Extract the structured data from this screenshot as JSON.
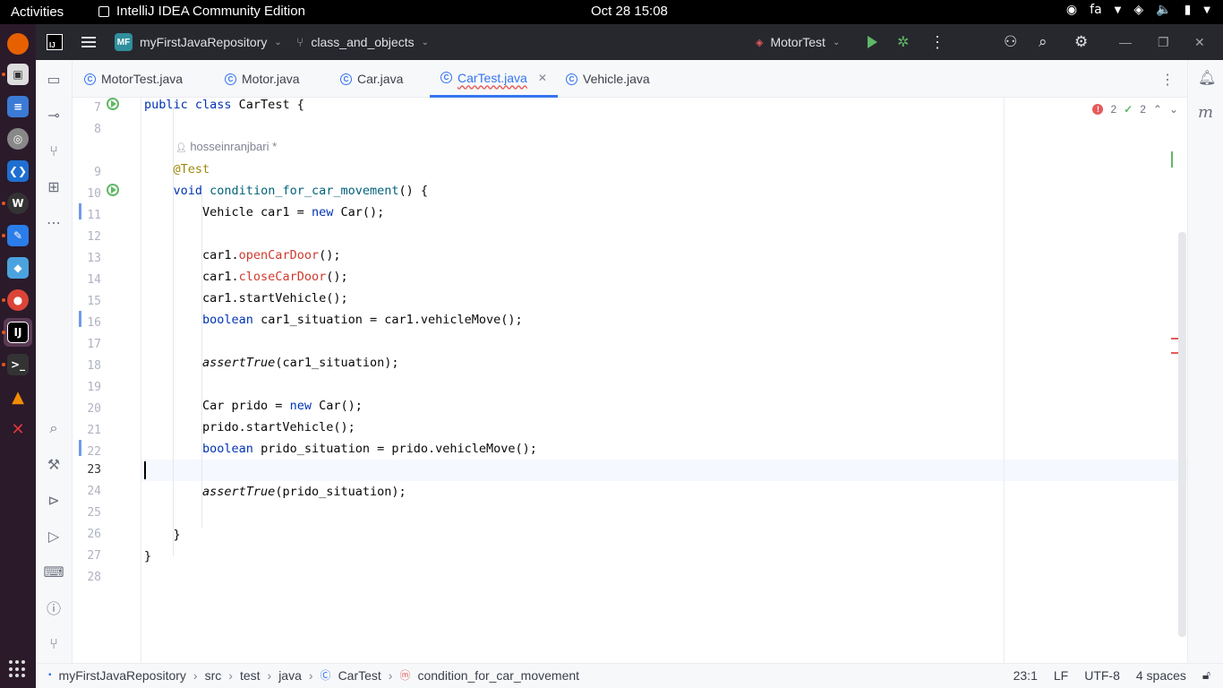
{
  "system": {
    "activities": "Activities",
    "app_name": "IntelliJ IDEA Community Edition",
    "clock": "Oct 28  15:08",
    "keyboard_layout": "fa"
  },
  "toolbar": {
    "project_badge": "MF",
    "project_name": "myFirstJavaRepository",
    "branch": "class_and_objects",
    "run_config": "MotorTest"
  },
  "tabs": [
    {
      "label": "MotorTest.java"
    },
    {
      "label": "Motor.java"
    },
    {
      "label": "Car.java"
    },
    {
      "label": "CarTest.java"
    },
    {
      "label": "Vehicle.java"
    }
  ],
  "editor": {
    "author_hint": "hosseinranjbari *",
    "errors_count": "2",
    "warnings_count": "2",
    "right_strip_letter": "m",
    "line_numbers": [
      "7",
      "8",
      "9",
      "10",
      "11",
      "12",
      "13",
      "14",
      "15",
      "16",
      "17",
      "18",
      "19",
      "20",
      "21",
      "22",
      "23",
      "24",
      "25",
      "26",
      "27",
      "28"
    ]
  },
  "statusbar": {
    "crumbs": [
      "myFirstJavaRepository",
      "src",
      "test",
      "java",
      "CarTest",
      "condition_for_car_movement"
    ],
    "position": "23:1",
    "line_sep": "LF",
    "encoding": "UTF-8",
    "indent": "4 spaces"
  },
  "colors": {
    "accent": "#3574f0",
    "keyword": "#0033b3",
    "annotation": "#9e880d",
    "error_method": "#cf3b2f",
    "run_green": "#5fb865"
  }
}
